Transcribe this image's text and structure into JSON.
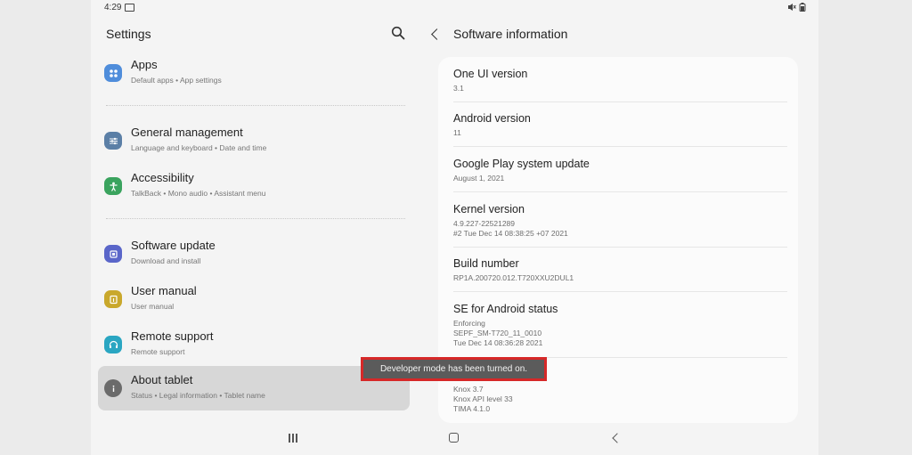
{
  "status_bar": {
    "time": "4:29"
  },
  "left_panel": {
    "title": "Settings",
    "items": [
      {
        "title": "Apps",
        "subtitle": "Default apps  •  App settings",
        "icon": "apps-icon",
        "color": "#4f8ddb"
      },
      {
        "title": "General management",
        "subtitle": "Language and keyboard  •  Date and time",
        "icon": "sliders-icon",
        "color": "#5b7fa6"
      },
      {
        "title": "Accessibility",
        "subtitle": "TalkBack  •  Mono audio  •  Assistant menu",
        "icon": "accessibility-icon",
        "color": "#3aa35e"
      },
      {
        "title": "Software update",
        "subtitle": "Download and install",
        "icon": "software-update-icon",
        "color": "#5a66c9"
      },
      {
        "title": "User manual",
        "subtitle": "User manual",
        "icon": "user-manual-icon",
        "color": "#c9a82c"
      },
      {
        "title": "Remote support",
        "subtitle": "Remote support",
        "icon": "headset-icon",
        "color": "#2aa6c2"
      },
      {
        "title": "About tablet",
        "subtitle": "Status  •  Legal information  •  Tablet name",
        "icon": "info-icon",
        "color": "#6b6b6b"
      }
    ]
  },
  "right_panel": {
    "title": "Software information",
    "entries": [
      {
        "title": "One UI version",
        "values": [
          "3.1"
        ]
      },
      {
        "title": "Android version",
        "values": [
          "11"
        ]
      },
      {
        "title": "Google Play system update",
        "values": [
          "August 1, 2021"
        ]
      },
      {
        "title": "Kernel version",
        "values": [
          "4.9.227-22521289",
          "#2 Tue Dec 14 08:38:25 +07 2021"
        ]
      },
      {
        "title": "Build number",
        "values": [
          "RP1A.200720.012.T720XXU2DUL1"
        ]
      },
      {
        "title": "SE for Android status",
        "values": [
          "Enforcing",
          "SEPF_SM-T720_11_0010",
          "Tue Dec 14 08:36:28 2021"
        ]
      },
      {
        "title": "",
        "values": [
          "Knox 3.7",
          "Knox API level 33",
          "TIMA 4.1.0"
        ]
      }
    ]
  },
  "toast": {
    "message": "Developer mode has been turned on."
  },
  "accent_colors": {
    "toast_border": "#d62828",
    "toast_bg": "#5b5b5b"
  }
}
